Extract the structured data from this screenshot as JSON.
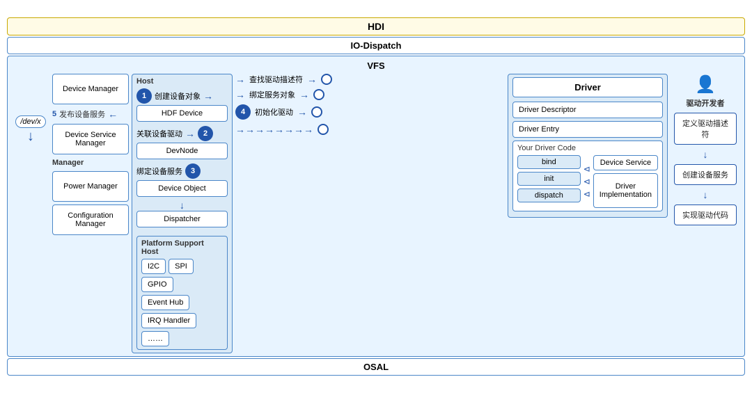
{
  "layers": {
    "hdi": "HDI",
    "io_dispatch": "IO-Dispatch",
    "vfs": "VFS",
    "osal": "OSAL"
  },
  "manager": {
    "label": "Manager",
    "device_manager": "Device Manager",
    "device_service_manager": "Device Service Manager",
    "power_manager": "Power Manager",
    "configuration_manager": "Configuration Manager"
  },
  "host": {
    "label": "Host",
    "hdf_device": "HDF Device",
    "devnode": "DevNode",
    "device_object": "Device Object",
    "dispatcher": "Dispatcher"
  },
  "steps": {
    "s1": "1",
    "s2": "2",
    "s3": "3",
    "s4": "4",
    "s5": "5",
    "create_device": "创建设备对象",
    "find_driver": "查找驱动描述符",
    "bind_service": "绑定服务对象",
    "init_driver": "初始化驱动",
    "publish_service": "发布设备服务",
    "associate_driver": "关联设备驱动",
    "bind_device_service": "绑定设备服务"
  },
  "platform": {
    "title": "Platform Support Host",
    "items": [
      "I2C",
      "SPI",
      "GPIO",
      "Event Hub",
      "IRQ Handler",
      "……"
    ]
  },
  "driver": {
    "title": "Driver",
    "descriptor": "Driver Descriptor",
    "entry": "Driver Entry",
    "your_driver_code": "Your Driver Code",
    "bind": "bind",
    "init": "init",
    "dispatch": "dispatch",
    "device_service": "Device Service",
    "driver_implementation": "Driver\nImplementation"
  },
  "developer": {
    "label": "驱动开发者",
    "step1": "定义驱动描述符",
    "step2": "创建设备服务",
    "step3": "实现驱动代码"
  },
  "devx": "/dev/x"
}
